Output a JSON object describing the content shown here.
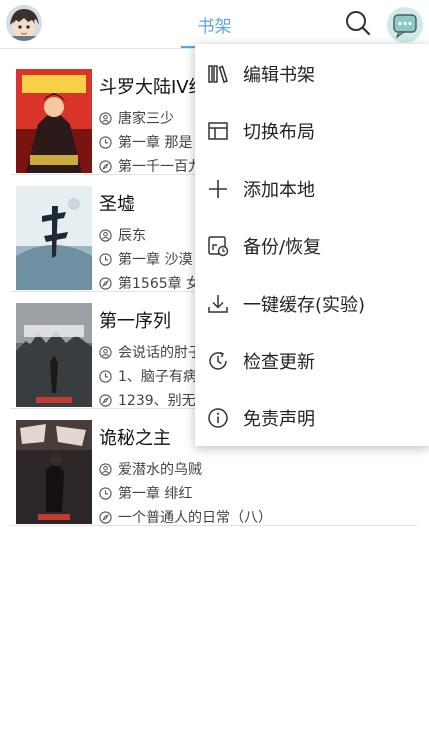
{
  "header": {
    "title": "书架",
    "avatar_icon": "anime-avatar",
    "search_icon": "search-icon",
    "message_icon": "chat-bubble-icon",
    "accent_color": "#5aa6e6"
  },
  "books": [
    {
      "name": "斗罗大陆IV终",
      "author": "唐家三少",
      "latest_read": "第一章 那是",
      "latest_chapter": "第一千一百九"
    },
    {
      "name": "圣墟",
      "author": "辰东",
      "latest_read": "第一章 沙漠",
      "latest_chapter": "第1565章 女"
    },
    {
      "name": "第一序列",
      "author": "会说话的肘子",
      "latest_read": "1、脑子有病",
      "latest_chapter": "1239、别无选"
    },
    {
      "name": "诡秘之主",
      "author": "爱潜水的乌贼",
      "latest_read": "第一章 绯红",
      "latest_chapter": "一个普通人的日常（八）"
    }
  ],
  "menu": {
    "items": [
      {
        "label": "编辑书架",
        "icon": "books-icon"
      },
      {
        "label": "切换布局",
        "icon": "layout-icon"
      },
      {
        "label": "添加本地",
        "icon": "plus-icon"
      },
      {
        "label": "备份/恢复",
        "icon": "backup-icon"
      },
      {
        "label": "一键缓存(实验)",
        "icon": "download-icon"
      },
      {
        "label": "检查更新",
        "icon": "update-icon"
      },
      {
        "label": "免责声明",
        "icon": "info-icon"
      }
    ]
  }
}
